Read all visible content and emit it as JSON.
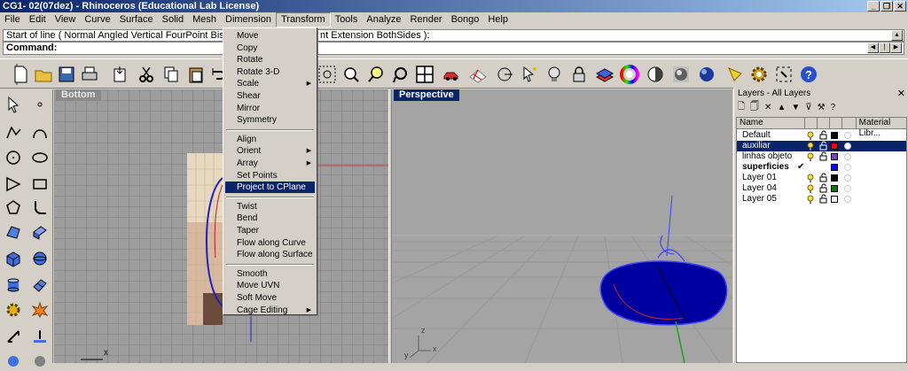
{
  "window": {
    "title": "CG1- 02(07dez) - Rhinoceros (Educational Lab License)",
    "controls": [
      "_",
      "❐",
      "✕"
    ]
  },
  "menubar": [
    "File",
    "Edit",
    "View",
    "Curve",
    "Surface",
    "Solid",
    "Mesh",
    "Dimension",
    "Transform",
    "Tools",
    "Analyze",
    "Render",
    "Bongo",
    "Help"
  ],
  "command": {
    "history_prefix": "Start of line ( Normal  Angled  Vertical  FourPoint  Bisecto",
    "history_suffix": "nt  Extension  BothSides ):",
    "prompt": "Command:"
  },
  "transform_menu": {
    "groups": [
      [
        {
          "label": "Move"
        },
        {
          "label": "Copy"
        },
        {
          "label": "Rotate"
        },
        {
          "label": "Rotate 3-D"
        },
        {
          "label": "Scale",
          "submenu": true
        },
        {
          "label": "Shear"
        },
        {
          "label": "Mirror"
        },
        {
          "label": "Symmetry"
        }
      ],
      [
        {
          "label": "Align"
        },
        {
          "label": "Orient",
          "submenu": true
        },
        {
          "label": "Array",
          "submenu": true
        },
        {
          "label": "Set Points"
        },
        {
          "label": "Project to CPlane",
          "highlighted": true
        }
      ],
      [
        {
          "label": "Twist"
        },
        {
          "label": "Bend"
        },
        {
          "label": "Taper"
        },
        {
          "label": "Flow along Curve"
        },
        {
          "label": "Flow along Surface"
        }
      ],
      [
        {
          "label": "Smooth"
        },
        {
          "label": "Move UVN"
        },
        {
          "label": "Soft Move"
        },
        {
          "label": "Cage Editing",
          "submenu": true
        }
      ]
    ]
  },
  "viewports": {
    "bottom": {
      "title": "Bottom",
      "axis_x": "x"
    },
    "perspective": {
      "title": "Perspective",
      "axis_x": "x",
      "axis_y": "y",
      "axis_z": "z"
    }
  },
  "layers_panel": {
    "title": "Layers - All Layers",
    "columns": {
      "name": "Name",
      "material": "Material Libr..."
    },
    "rows": [
      {
        "name": "Default",
        "color": "#000000",
        "bold": false,
        "selected": false,
        "check": ""
      },
      {
        "name": "auxiliar",
        "color": "#ff0000",
        "bold": false,
        "selected": true,
        "check": ""
      },
      {
        "name": "linhas objeto",
        "color": "#8040c0",
        "bold": false,
        "selected": false,
        "check": ""
      },
      {
        "name": "superficies",
        "color": "#0000ff",
        "bold": true,
        "selected": false,
        "check": "✔"
      },
      {
        "name": "Layer 01",
        "color": "#000000",
        "bold": false,
        "selected": false,
        "check": ""
      },
      {
        "name": "Layer 04",
        "color": "#008000",
        "bold": false,
        "selected": false,
        "check": ""
      },
      {
        "name": "Layer 05",
        "color": "#ffffff",
        "bold": false,
        "selected": false,
        "check": ""
      }
    ]
  },
  "colors": {
    "title_dark": "#0a246a",
    "title_light": "#a6caf0",
    "surface_blue": "#0000a0"
  }
}
